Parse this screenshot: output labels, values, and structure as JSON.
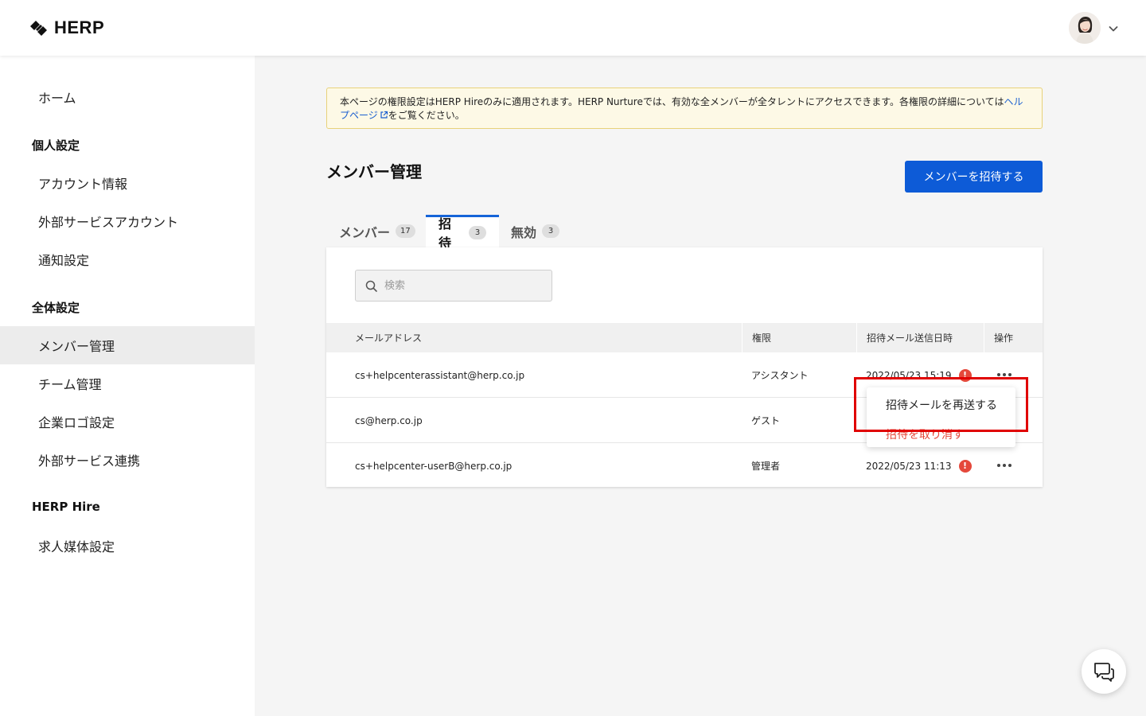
{
  "header": {
    "logo_text": "HERP"
  },
  "sidebar": {
    "home": "ホーム",
    "personal_heading": "個人設定",
    "personal_items": [
      "アカウント情報",
      "外部サービスアカウント",
      "通知設定"
    ],
    "global_heading": "全体設定",
    "global_items": [
      "メンバー管理",
      "チーム管理",
      "企業ロゴ設定",
      "外部サービス連携"
    ],
    "hire_heading": "HERP Hire",
    "hire_items": [
      "求人媒体設定"
    ],
    "active_item": "メンバー管理"
  },
  "notice": {
    "text": "本ページの権限設定はHERP Hireのみに適用されます。HERP Nurtureでは、有効な全メンバーが全タレントにアクセスできます。各権限の詳細については",
    "link_text": "ヘルプページ",
    "suffix": "をご覧ください。"
  },
  "page": {
    "title": "メンバー管理",
    "invite_button": "メンバーを招待する"
  },
  "tabs": [
    {
      "label": "メンバー",
      "count": "17",
      "active": false
    },
    {
      "label": "招待",
      "count": "3",
      "active": true
    },
    {
      "label": "無効",
      "count": "3",
      "active": false
    }
  ],
  "search": {
    "placeholder": "検索"
  },
  "table": {
    "headers": [
      "メールアドレス",
      "権限",
      "招待メール送信日時",
      "操作"
    ],
    "rows": [
      {
        "email": "cs+helpcenterassistant@herp.co.jp",
        "role": "アシスタント",
        "sent": "2022/05/23 15:19"
      },
      {
        "email": "cs@herp.co.jp",
        "role": "ゲスト",
        "sent": ""
      },
      {
        "email": "cs+helpcenter-userB@herp.co.jp",
        "role": "管理者",
        "sent": "2022/05/23 11:13"
      }
    ],
    "warning_glyph": "!"
  },
  "dropdown": {
    "items": [
      "招待メールを再送する",
      "招待を取り消す"
    ],
    "danger_color": "#e5483b"
  },
  "colors": {
    "primary": "#0d5bd7",
    "highlight_border": "#e00000",
    "notice_bg": "#fdf9e6"
  }
}
